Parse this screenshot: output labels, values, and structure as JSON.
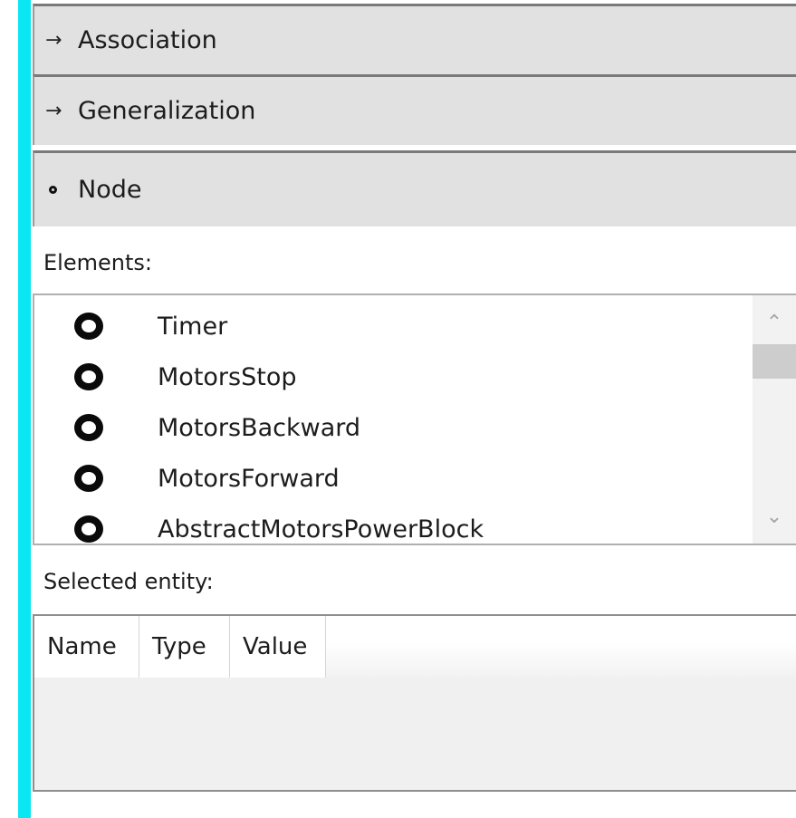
{
  "expanders": [
    {
      "glyph": "→",
      "label": "Association"
    },
    {
      "glyph": "→",
      "label": "Generalization"
    },
    {
      "glyph": "",
      "label": "Node"
    }
  ],
  "elements": {
    "label": "Elements:",
    "items": [
      {
        "label": "Timer"
      },
      {
        "label": "MotorsStop"
      },
      {
        "label": "MotorsBackward"
      },
      {
        "label": "MotorsForward"
      },
      {
        "label": "AbstractMotorsPowerBlock"
      }
    ],
    "scroll_up_glyph": "⌃",
    "scroll_down_glyph": "⌄"
  },
  "selected_entity": {
    "label": "Selected entity:",
    "columns": [
      "Name",
      "Type",
      "Value"
    ]
  },
  "colors": {
    "accent": "#0ae6f2",
    "expander_bg": "#e1e1e1"
  }
}
